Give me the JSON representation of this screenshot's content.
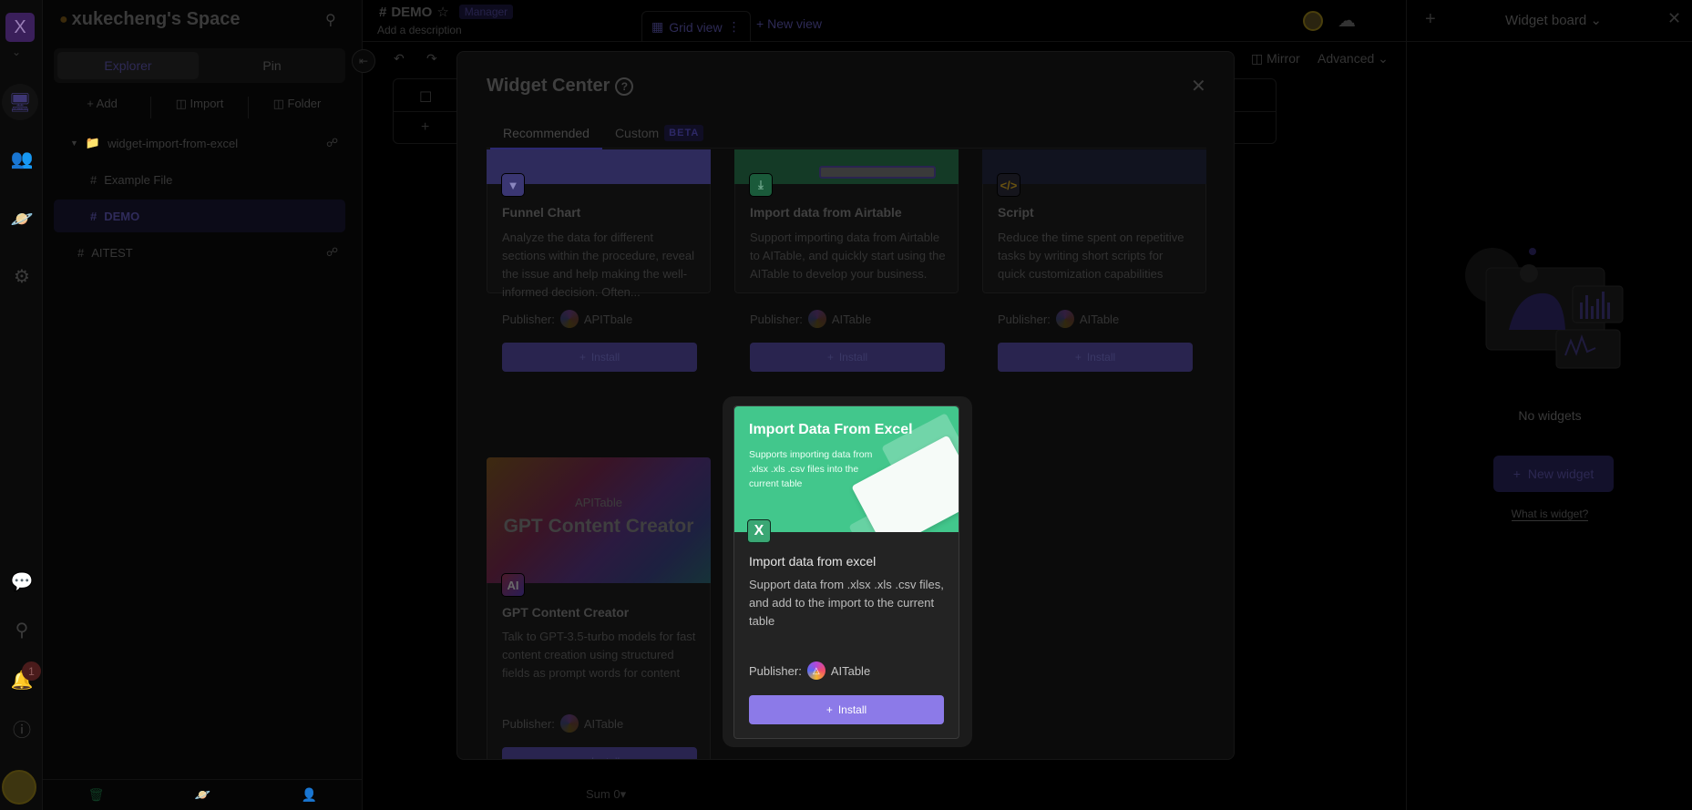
{
  "rail": {
    "logo_letter": "X",
    "notification_count": "1",
    "icons": [
      "workbench-icon",
      "contacts-icon",
      "explore-icon",
      "settings-icon"
    ],
    "bottom_icons": [
      "chat-icon",
      "search-icon",
      "bell-icon",
      "help-icon"
    ]
  },
  "sidebar": {
    "space_name": "xukecheng's Space",
    "tabs": [
      {
        "label": "Explorer",
        "active": true
      },
      {
        "label": "Pin",
        "active": false
      }
    ],
    "actions": {
      "add": "+ Add",
      "import": "Import",
      "folder": "Folder"
    },
    "tree": [
      {
        "label": "widget-import-from-excel",
        "type": "folder",
        "expanded": true
      },
      {
        "label": "Example File",
        "type": "datasheet"
      },
      {
        "label": "DEMO",
        "type": "datasheet",
        "active": true
      },
      {
        "label": "AITEST",
        "type": "datasheet"
      }
    ]
  },
  "header": {
    "datasheet_name": "DEMO",
    "role": "Manager",
    "description_placeholder": "Add a description",
    "view_tab": "Grid view",
    "new_view": "New view"
  },
  "toolbar": {
    "mirror": "Mirror",
    "advanced": "Advanced"
  },
  "footer": {
    "sum": "Sum 0"
  },
  "widget_board": {
    "title": "Widget board",
    "empty_text": "No widgets",
    "new_widget": "New widget",
    "what_is": "What is widget?"
  },
  "modal": {
    "title": "Widget Center",
    "tabs": [
      {
        "label": "Recommended",
        "active": true
      },
      {
        "label": "Custom",
        "badge": "BETA",
        "active": false
      }
    ],
    "install_label": "Install",
    "publisher_label": "Publisher:",
    "cards": [
      {
        "title": "Funnel Chart",
        "description": "Analyze the data for different sections within the procedure, reveal the issue and help making the well-informed decision. Often...",
        "publisher": "APITbale",
        "icon": "funnel-icon",
        "accent": "#2e2b5c"
      },
      {
        "title": "Import data from Airtable",
        "description": "Support importing data from Airtable to AITable, and quickly start using the AITable to develop your business.",
        "publisher": "AITable",
        "icon": "download-icon",
        "accent": "#143a26"
      },
      {
        "title": "Script",
        "description": "Reduce the time spent on repetitive tasks by writing short scripts for quick customization capabilities",
        "publisher": "AITable",
        "icon": "code-icon",
        "accent": "#11131f"
      },
      {
        "title": "GPT Content Creator",
        "description": "Talk to GPT-3.5-turbo models for fast content creation using structured fields as prompt words for content",
        "publisher": "AITable",
        "icon": "ai-icon",
        "banner_brand": "APITable",
        "banner_title": "GPT Content Creator"
      },
      {
        "title": "Import data from excel",
        "description": "Support data from .xlsx .xls .csv files, and add to the import to the current table",
        "publisher": "AITable",
        "icon": "excel-icon",
        "icon_letter": "X",
        "banner_title": "Import Data From Excel",
        "banner_subtitle": "Supports importing data from .xlsx .xls .csv files into the current table",
        "highlighted": true,
        "accent": "#42c78c",
        "button_color": "#8c7ae8"
      }
    ]
  }
}
